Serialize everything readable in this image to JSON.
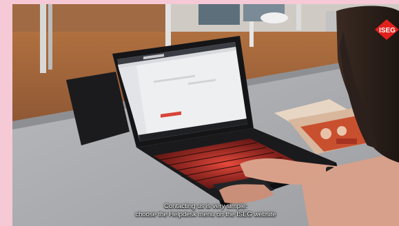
{
  "video": {
    "caption_lines": [
      "Contacting us is very simple:",
      "choose the Helpdesk menu on the ISEG website"
    ]
  },
  "logo": {
    "text": "ISEG",
    "color": "#e2201c",
    "icon": "iseg-logo-icon"
  },
  "colors": {
    "side_panel": "#f6c9d6",
    "laptop_keyboard_backlight": "#e0302a"
  }
}
